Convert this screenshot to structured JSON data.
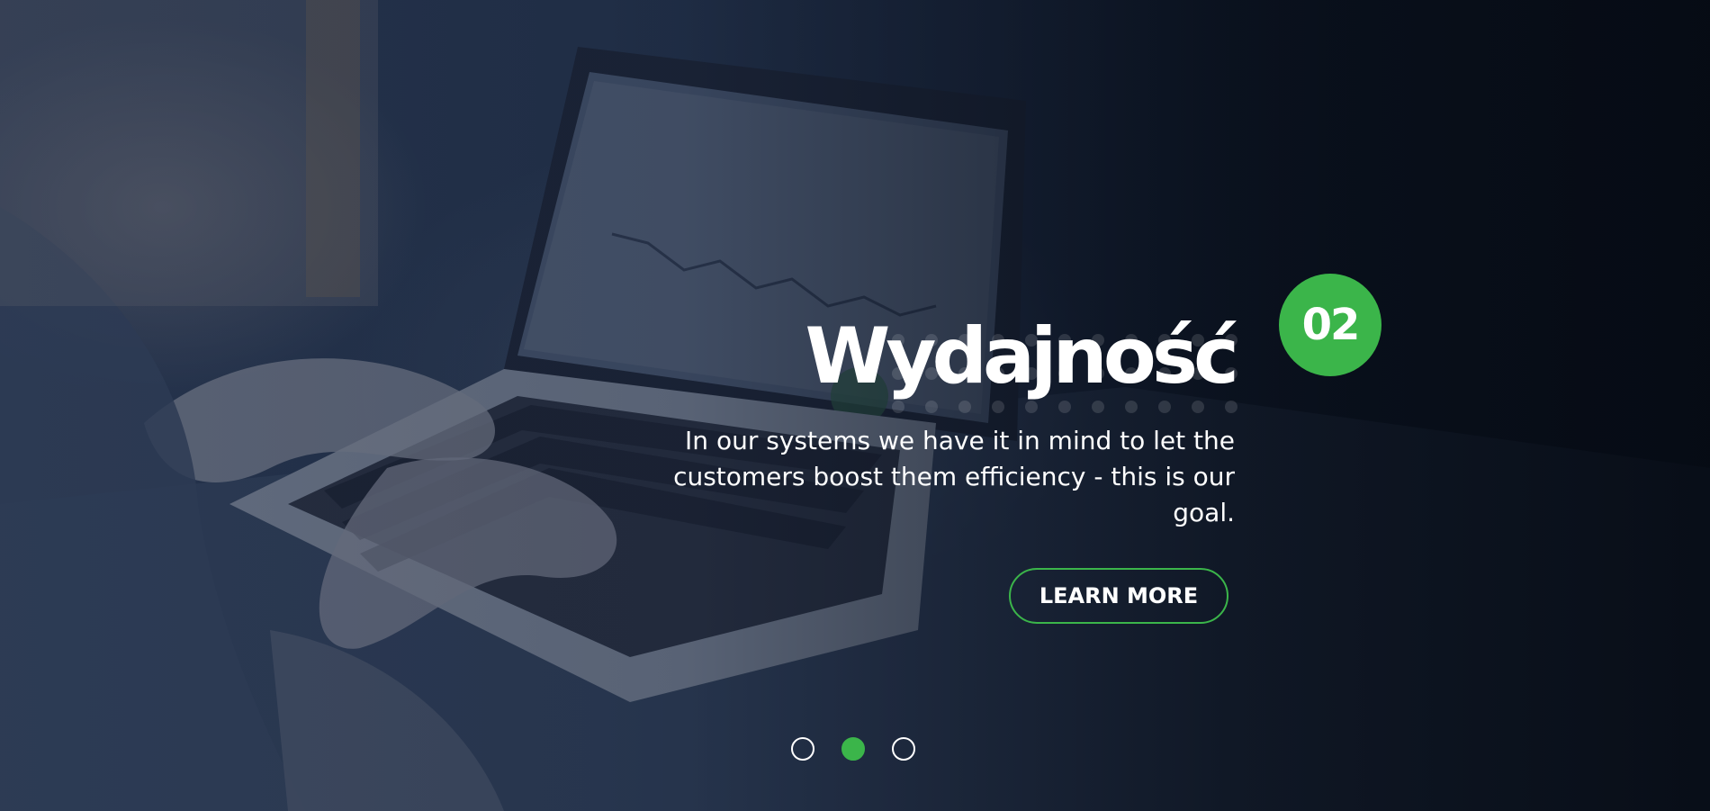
{
  "slide": {
    "number": "02",
    "title": "Wydajność",
    "description": "In our systems we have it in mind to let the customers boost them efficiency - this is our goal.",
    "cta_label": "LEARN MORE"
  },
  "pager": {
    "total": 3,
    "active_index": 1
  },
  "colors": {
    "accent": "#3bb54a",
    "text": "#ffffff",
    "background_dark": "#0b1420"
  }
}
